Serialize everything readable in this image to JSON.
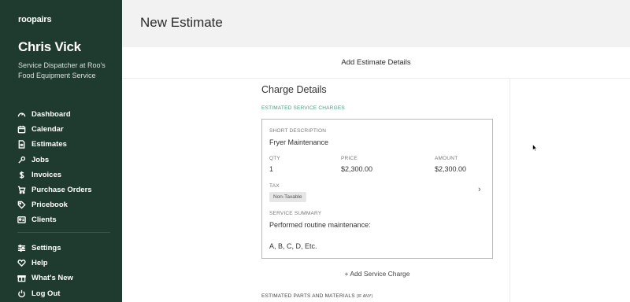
{
  "sidebar": {
    "logo": "roopairs",
    "user_name": "Chris Vick",
    "user_role": "Service Dispatcher at Roo's Food Equipment Service",
    "nav_main": [
      {
        "label": "Dashboard",
        "icon": "gauge-icon"
      },
      {
        "label": "Calendar",
        "icon": "calendar-icon"
      },
      {
        "label": "Estimates",
        "icon": "document-icon"
      },
      {
        "label": "Jobs",
        "icon": "wrench-icon"
      },
      {
        "label": "Invoices",
        "icon": "dollar-icon"
      },
      {
        "label": "Purchase Orders",
        "icon": "cart-icon"
      },
      {
        "label": "Pricebook",
        "icon": "tag-icon"
      },
      {
        "label": "Clients",
        "icon": "contact-card-icon"
      }
    ],
    "nav_bottom": [
      {
        "label": "Settings",
        "icon": "sliders-icon"
      },
      {
        "label": "Help",
        "icon": "heart-icon"
      },
      {
        "label": "What's New",
        "icon": "gift-icon"
      },
      {
        "label": "Log Out",
        "icon": "power-icon"
      }
    ]
  },
  "header": {
    "title": "New Estimate"
  },
  "card": {
    "title": "Add Estimate Details",
    "section_title": "Charge Details",
    "estimated_service_charges": "ESTIMATED SERVICE CHARGES",
    "charge": {
      "short_description_label": "SHORT DESCRIPTION",
      "short_description": "Fryer Maintenance",
      "qty_label": "QTY",
      "qty": "1",
      "price_label": "PRICE",
      "price": "$2,300.00",
      "amount_label": "AMOUNT",
      "amount": "$2,300.00",
      "tax_label": "TAX",
      "tax_value": "Non-Taxable",
      "service_summary_label": "SERVICE SUMMARY",
      "service_summary_line1": "Performed routine maintenance:",
      "service_summary_line2": "A, B, C, D, Etc."
    },
    "add_service_charge": "+ Add Service Charge",
    "estimated_parts_label": "ESTIMATED PARTS AND MATERIALS",
    "estimated_parts_suffix": "(IF ANY)"
  }
}
